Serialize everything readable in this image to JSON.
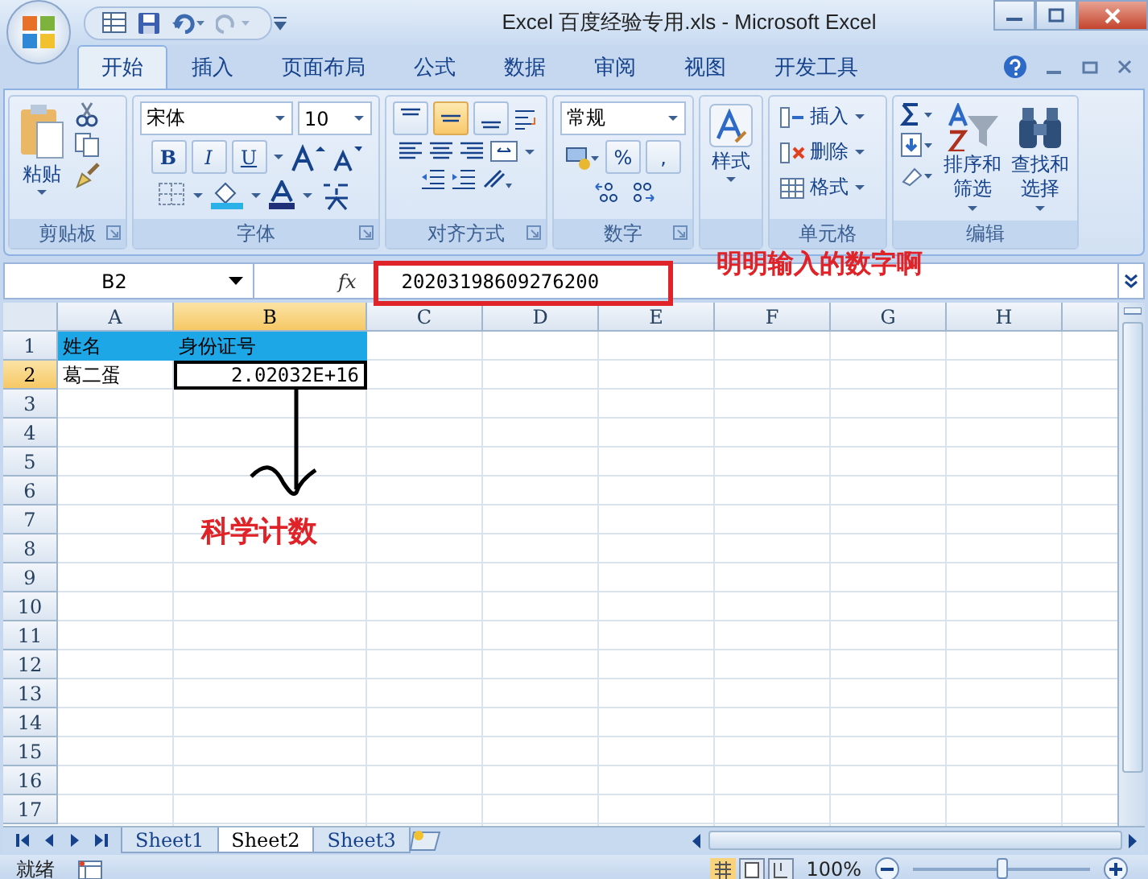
{
  "window": {
    "title": "Excel 百度经验专用.xls - Microsoft Excel"
  },
  "tabs": [
    {
      "label": "开始",
      "selected": true
    },
    {
      "label": "插入",
      "selected": false
    },
    {
      "label": "页面布局",
      "selected": false
    },
    {
      "label": "公式",
      "selected": false
    },
    {
      "label": "数据",
      "selected": false
    },
    {
      "label": "审阅",
      "selected": false
    },
    {
      "label": "视图",
      "selected": false
    },
    {
      "label": "开发工具",
      "selected": false
    }
  ],
  "ribbon": [
    {
      "kind": "clipboard",
      "label": "剪贴板",
      "paste": "粘贴"
    },
    {
      "kind": "font",
      "label": "字体",
      "font": "宋体",
      "size": "10",
      "styles": [
        "B",
        "I",
        "U"
      ]
    },
    {
      "kind": "alignment",
      "label": "对齐方式",
      "vertical": [
        {
          "selected": false
        },
        {
          "selected": true
        },
        {
          "selected": false
        }
      ]
    },
    {
      "kind": "number",
      "label": "数字",
      "format": "常规",
      "symbols": [
        "%",
        ","
      ]
    },
    {
      "kind": "styles",
      "button": "样式"
    },
    {
      "kind": "cells",
      "label": "单元格",
      "items": [
        "插入",
        "删除",
        "格式"
      ]
    },
    {
      "kind": "editing",
      "label": "编辑",
      "sort": [
        "排序和",
        "筛选"
      ],
      "find": [
        "查找和",
        "选择"
      ]
    }
  ],
  "formula_bar": {
    "name_box": "B2",
    "fx": "fx",
    "value": "20203198609276200"
  },
  "columns": [
    {
      "label": "A",
      "selected": false
    },
    {
      "label": "B",
      "selected": true
    },
    {
      "label": "C",
      "selected": false
    },
    {
      "label": "D",
      "selected": false
    },
    {
      "label": "E",
      "selected": false
    },
    {
      "label": "F",
      "selected": false
    },
    {
      "label": "G",
      "selected": false
    },
    {
      "label": "H",
      "selected": false
    }
  ],
  "rows": [
    {
      "header": "1",
      "selected": false,
      "cells": [
        {
          "text": "姓名",
          "kind": "text",
          "highlighted": true,
          "selected": false
        },
        {
          "text": "身份证号",
          "kind": "text",
          "highlighted": true,
          "selected": false
        }
      ]
    },
    {
      "header": "2",
      "selected": true,
      "cells": [
        {
          "text": "葛二蛋",
          "kind": "text",
          "highlighted": false,
          "selected": false
        },
        {
          "text": "2.02032E+16",
          "kind": "number",
          "highlighted": false,
          "selected": true
        }
      ]
    },
    {
      "header": "3",
      "selected": false
    },
    {
      "header": "4",
      "selected": false
    },
    {
      "header": "5",
      "selected": false
    },
    {
      "header": "6",
      "selected": false
    },
    {
      "header": "7",
      "selected": false
    },
    {
      "header": "8",
      "selected": false
    },
    {
      "header": "9",
      "selected": false
    },
    {
      "header": "10",
      "selected": false
    },
    {
      "header": "11",
      "selected": false
    },
    {
      "header": "12",
      "selected": false
    },
    {
      "header": "13",
      "selected": false
    },
    {
      "header": "14",
      "selected": false
    },
    {
      "header": "15",
      "selected": false
    },
    {
      "header": "16",
      "selected": false
    },
    {
      "header": "17",
      "selected": false
    }
  ],
  "sheet_tabs": [
    {
      "label": "Sheet1",
      "selected": false
    },
    {
      "label": "Sheet2",
      "selected": true
    },
    {
      "label": "Sheet3",
      "selected": false
    }
  ],
  "status_bar": {
    "text": "就绪",
    "zoom": "100%",
    "level": 0.5
  },
  "annotations": {
    "note": "明明输入的数字啊",
    "arrow_label": "科学计数"
  }
}
